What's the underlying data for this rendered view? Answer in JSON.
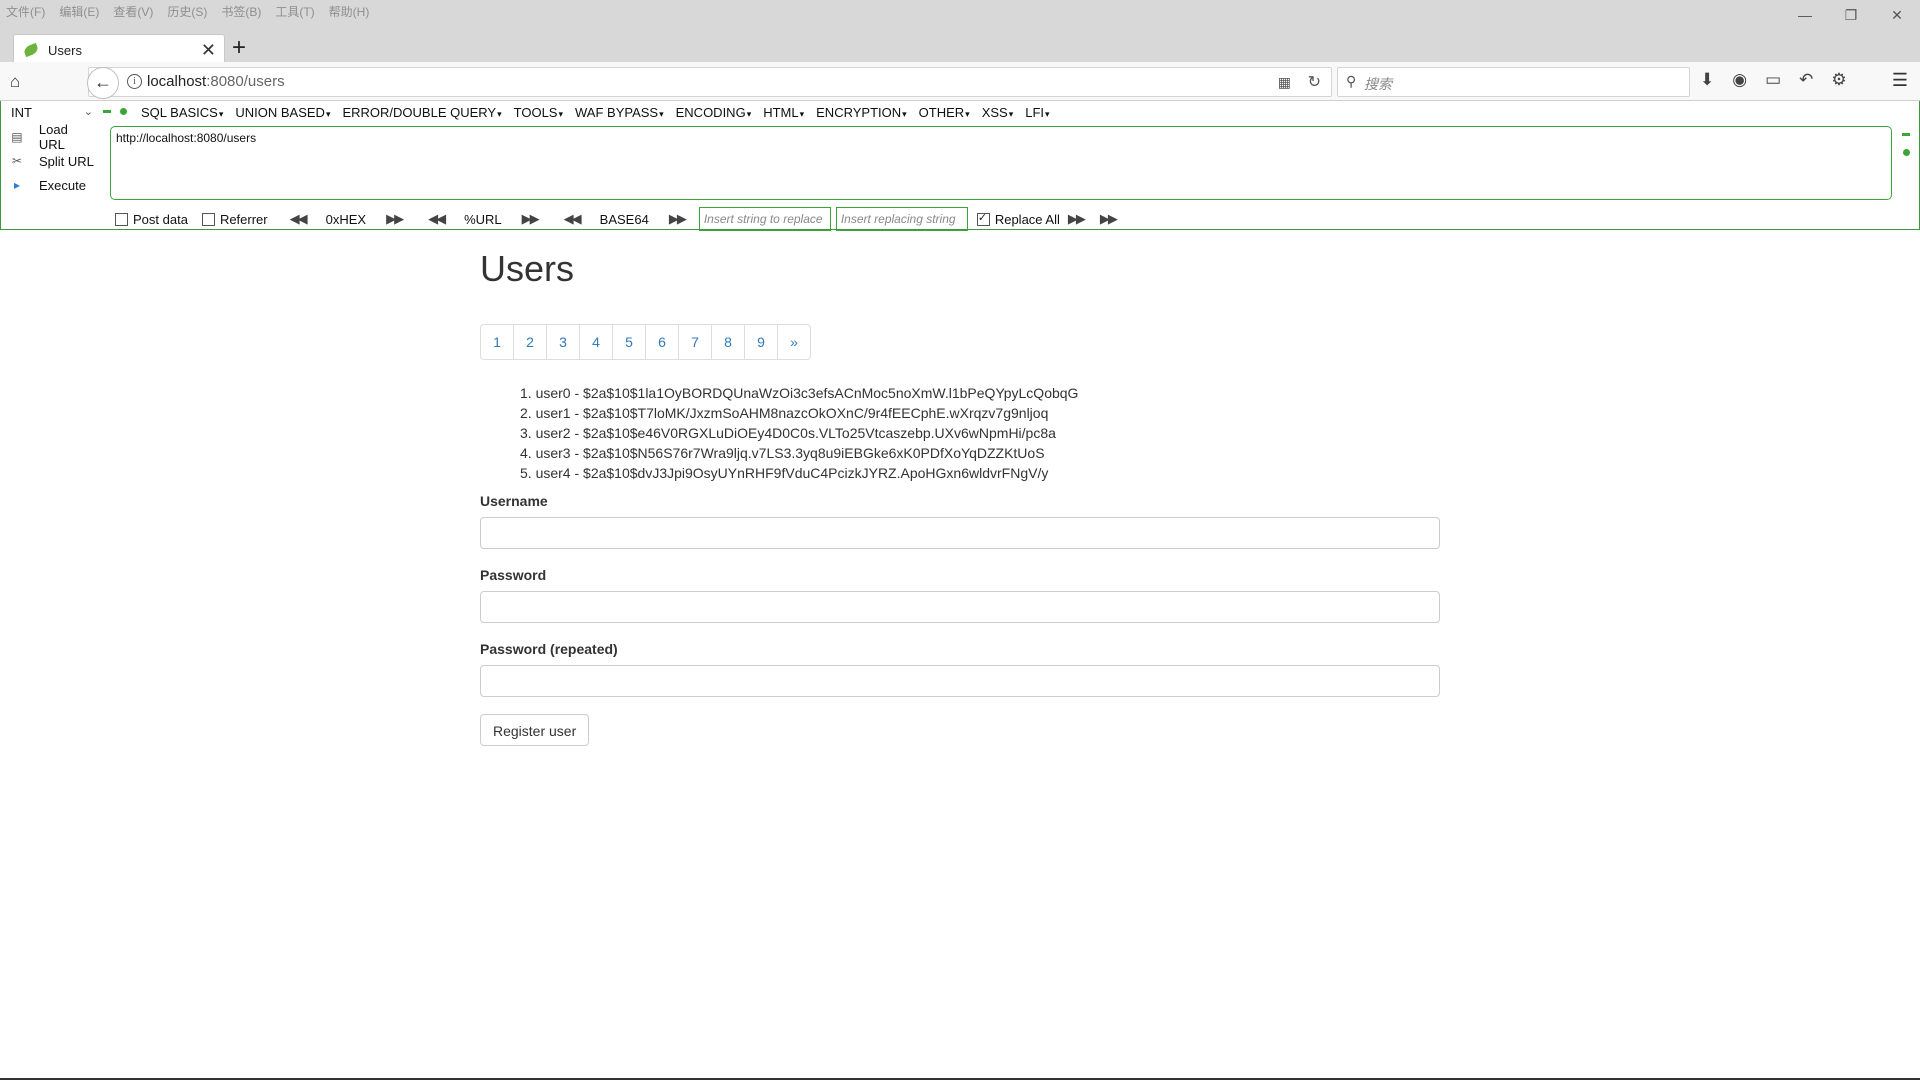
{
  "menu": [
    "文件(F)",
    "编辑(E)",
    "查看(V)",
    "历史(S)",
    "书签(B)",
    "工具(T)",
    "帮助(H)"
  ],
  "window_controls": {
    "minimize": "—",
    "restore": "❐",
    "close": "✕"
  },
  "tab": {
    "title": "Users",
    "close": "✕",
    "new": "+"
  },
  "nav": {
    "home": "⌂",
    "back": "←",
    "info": "i",
    "url_host": "localhost",
    "url_rest": ":8080/users",
    "qr": "▦",
    "reload": "↻",
    "search_icon": "⚲",
    "search_placeholder": "搜索",
    "tools": [
      "⬇",
      "◉",
      "▭",
      "↶",
      "⚙"
    ],
    "menu": "☰"
  },
  "hackbar": {
    "select_value": "INT",
    "select_chevron": "⌄",
    "menus": [
      "SQL BASICS",
      "UNION BASED",
      "ERROR/DOUBLE QUERY",
      "TOOLS",
      "WAF BYPASS",
      "ENCODING",
      "HTML",
      "ENCRYPTION",
      "OTHER",
      "XSS",
      "LFI"
    ],
    "actions": [
      {
        "icon": "▤",
        "label": "Load URL"
      },
      {
        "icon": "✂",
        "label": "Split URL"
      },
      {
        "icon": "▸",
        "label": "Execute"
      }
    ],
    "url_value": "http://localhost:8080/users",
    "post_data": "Post data",
    "referrer": "Referrer",
    "hex": "0xHEX",
    "url_enc": "%URL",
    "base64": "BASE64",
    "replace_placeholder": "Insert string to replace",
    "replacing_placeholder": "Insert replacing string",
    "replace_all": "Replace All",
    "arrow_left": "◀◀",
    "arrow_right": "▶▶"
  },
  "page": {
    "title": "Users",
    "pagination": [
      "1",
      "2",
      "3",
      "4",
      "5",
      "6",
      "7",
      "8",
      "9",
      "»"
    ],
    "users": [
      "1. user0 - $2a$10$1la1OyBORDQUnaWzOi3c3efsACnMoc5noXmW.l1bPeQYpyLcQobqG",
      "2. user1 - $2a$10$T7loMK/JxzmSoAHM8nazcOkOXnC/9r4fEECphE.wXrqzv7g9nljoq",
      "3. user2 - $2a$10$e46V0RGXLuDiOEy4D0C0s.VLTo25Vtcaszebp.UXv6wNpmHi/pc8a",
      "4. user3 - $2a$10$N56S76r7Wra9ljq.v7LS3.3yq8u9iEBGke6xK0PDfXoYqDZZKtUoS",
      "5. user4 - $2a$10$dvJ3Jpi9OsyUYnRHF9fVduC4PcizkJYRZ.ApoHGxn6wldvrFNgV/y"
    ],
    "username_label": "Username",
    "password_label": "Password",
    "password_repeat_label": "Password (repeated)",
    "register_button": "Register user"
  }
}
